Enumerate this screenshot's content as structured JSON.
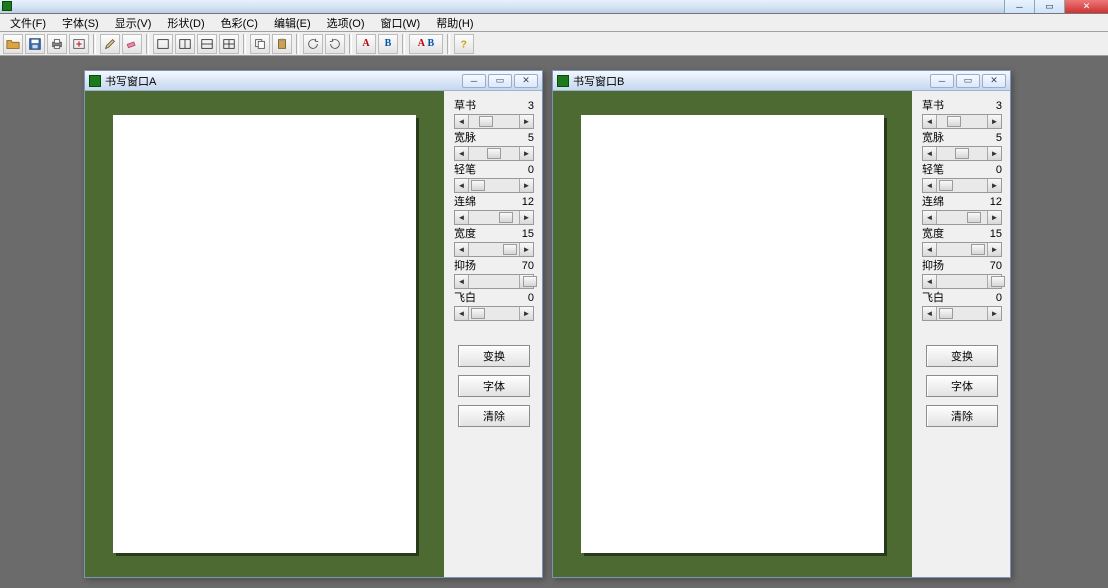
{
  "os": {
    "min": "─",
    "max": "▭",
    "close": "✕"
  },
  "menu": {
    "file": "文件(F)",
    "font": "字体(S)",
    "view": "显示(V)",
    "shape": "形状(D)",
    "color": "色彩(C)",
    "edit": "编辑(E)",
    "option": "选项(O)",
    "window": "窗口(W)",
    "help": "帮助(H)"
  },
  "childA": {
    "title": "书写窗口A",
    "controls": {
      "min": "─",
      "max": "▭",
      "close": "✕"
    }
  },
  "childB": {
    "title": "书写窗口B",
    "controls": {
      "min": "─",
      "max": "▭",
      "close": "✕"
    }
  },
  "panelA": {
    "params": [
      {
        "label": "草书",
        "value": "3",
        "thumb": 10
      },
      {
        "label": "宽脉",
        "value": "5",
        "thumb": 18
      },
      {
        "label": "轻笔",
        "value": "0",
        "thumb": 2
      },
      {
        "label": "连绵",
        "value": "12",
        "thumb": 30
      },
      {
        "label": "宽度",
        "value": "15",
        "thumb": 34
      },
      {
        "label": "抑扬",
        "value": "70",
        "thumb": 54
      },
      {
        "label": "飞白",
        "value": "0",
        "thumb": 2
      }
    ],
    "buttons": {
      "transform": "变换",
      "font": "字体",
      "clear": "清除"
    }
  },
  "panelB": {
    "params": [
      {
        "label": "草书",
        "value": "3",
        "thumb": 10
      },
      {
        "label": "宽脉",
        "value": "5",
        "thumb": 18
      },
      {
        "label": "轻笔",
        "value": "0",
        "thumb": 2
      },
      {
        "label": "连绵",
        "value": "12",
        "thumb": 30
      },
      {
        "label": "宽度",
        "value": "15",
        "thumb": 34
      },
      {
        "label": "抑扬",
        "value": "70",
        "thumb": 54
      },
      {
        "label": "飞白",
        "value": "0",
        "thumb": 2
      }
    ],
    "buttons": {
      "transform": "变换",
      "font": "字体",
      "clear": "清除"
    }
  }
}
